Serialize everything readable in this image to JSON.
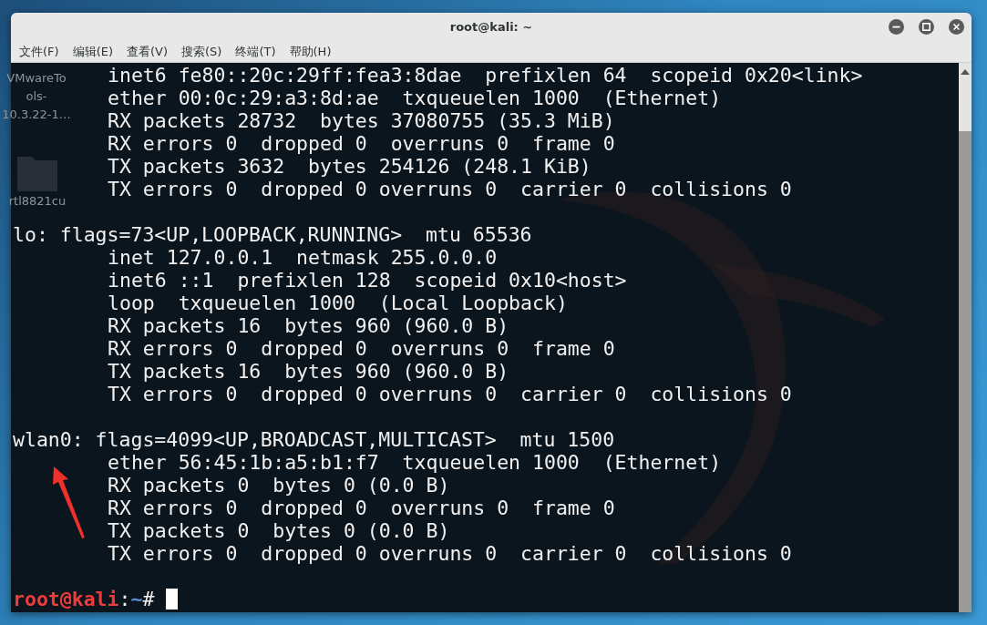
{
  "desktop_icons": [
    {
      "label_lines": [
        "VMwareTo",
        "ols-",
        "10.3.22-1…"
      ]
    },
    {
      "label_lines": [
        "rtl8821cu"
      ]
    }
  ],
  "window": {
    "title": "root@kali: ~"
  },
  "menu": [
    "文件(F)",
    "编辑(E)",
    "查看(V)",
    "搜索(S)",
    "终端(T)",
    "帮助(H)"
  ],
  "terminal": {
    "interfaces": [
      {
        "details": [
          "inet6 fe80::20c:29ff:fea3:8dae  prefixlen 64  scopeid 0x20<link>",
          "ether 00:0c:29:a3:8d:ae  txqueuelen 1000  (Ethernet)",
          "RX packets 28732  bytes 37080755 (35.3 MiB)",
          "RX errors 0  dropped 0  overruns 0  frame 0",
          "TX packets 3632  bytes 254126 (248.1 KiB)",
          "TX errors 0  dropped 0 overruns 0  carrier 0  collisions 0"
        ]
      },
      {
        "header": "lo: flags=73<UP,LOOPBACK,RUNNING>  mtu 65536",
        "details": [
          "inet 127.0.0.1  netmask 255.0.0.0",
          "inet6 ::1  prefixlen 128  scopeid 0x10<host>",
          "loop  txqueuelen 1000  (Local Loopback)",
          "RX packets 16  bytes 960 (960.0 B)",
          "RX errors 0  dropped 0  overruns 0  frame 0",
          "TX packets 16  bytes 960 (960.0 B)",
          "TX errors 0  dropped 0 overruns 0  carrier 0  collisions 0"
        ]
      },
      {
        "header": "wlan0: flags=4099<UP,BROADCAST,MULTICAST>  mtu 1500",
        "details": [
          "ether 56:45:1b:a5:b1:f7  txqueuelen 1000  (Ethernet)",
          "RX packets 0  bytes 0 (0.0 B)",
          "RX errors 0  dropped 0  overruns 0  frame 0",
          "TX packets 0  bytes 0 (0.0 B)",
          "TX errors 0  dropped 0 overruns 0  carrier 0  collisions 0"
        ]
      }
    ],
    "prompt": {
      "user_host": "root@kali",
      "separator": ":",
      "path": "~",
      "symbol": "#"
    }
  }
}
